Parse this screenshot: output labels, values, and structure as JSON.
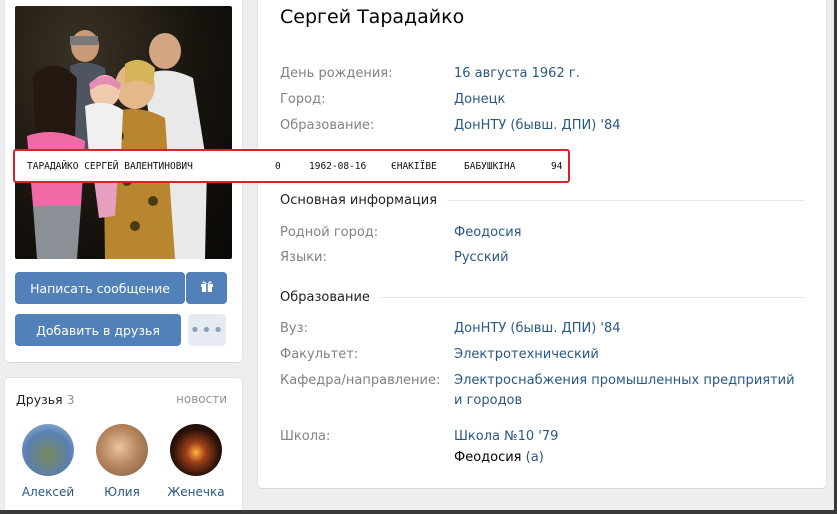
{
  "profile": {
    "name": "Сергей Тарадайко",
    "rows_top": [
      {
        "label": "День рождения:",
        "value": "16 августа 1962 г."
      },
      {
        "label": "Город:",
        "value": "Донецк"
      },
      {
        "label": "Образование:",
        "value": "ДонНТУ (бывш. ДПИ) '84"
      }
    ]
  },
  "record": {
    "name": "ТАРАДАЙКО СЕРГЕЙ ВАЛЕНТИНОВИЧ",
    "code": "0",
    "date": "1962-08-16",
    "town": "ЄНАКІЇВЕ",
    "street": "БАБУШКІНА",
    "num": "94"
  },
  "basic_info": {
    "heading": "Основная информация",
    "rows": [
      {
        "label": "Родной город:",
        "value": "Феодосия"
      },
      {
        "label": "Языки:",
        "value": "Русский"
      }
    ]
  },
  "education": {
    "heading": "Образование",
    "rows": [
      {
        "label": "Вуз:",
        "value": "ДонНТУ (бывш. ДПИ) '84"
      },
      {
        "label": "Факультет:",
        "value": "Электротехнический"
      },
      {
        "label": "Кафедра/направление:",
        "value": "Электроснабжения промышленных предприятий и городов"
      },
      {
        "label": "Школа:",
        "value": "Школа №10 '79",
        "extra_city": "Феодосия",
        "extra_paren": "(а)"
      }
    ]
  },
  "actions": {
    "message": "Написать сообщение",
    "add_friend": "Добавить в друзья",
    "more": "•••"
  },
  "icons": {
    "gift": "gift-icon",
    "more": "more-icon"
  },
  "friends": {
    "label": "Друзья",
    "count": "3",
    "news": "новости",
    "list": [
      {
        "name": "Алексей"
      },
      {
        "name": "Юлия"
      },
      {
        "name": "Женечка"
      }
    ]
  },
  "colors": {
    "link": "#2a5885",
    "button": "#5181b8",
    "highlight_border": "#d9232b"
  }
}
